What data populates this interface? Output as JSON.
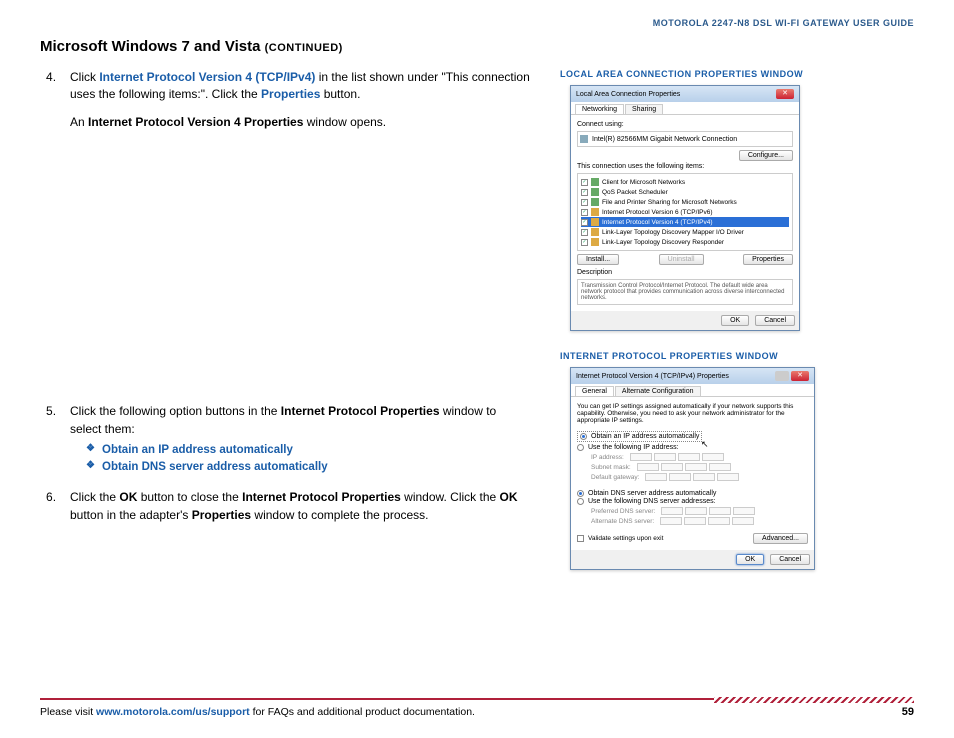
{
  "header": {
    "guide_title": "MOTOROLA 2247-N8 DSL WI-FI GATEWAY USER GUIDE"
  },
  "title": {
    "main": "Microsoft Windows 7 and Vista",
    "cont": "(CONTINUED)"
  },
  "steps": {
    "s4": {
      "pre": "Click ",
      "link": "Internet Protocol Version 4 (TCP/IPv4)",
      "mid": " in the list shown under \"This connection uses the following items:\". Click the ",
      "link2": "Properties",
      "end": " button.",
      "sub_pre": "An ",
      "sub_bold": "Internet Protocol Version 4 Properties",
      "sub_end": " window opens."
    },
    "s5": {
      "pre": "Click the following option buttons in the ",
      "bold": "Internet Protocol Properties",
      "end": " window to select them:",
      "opt1": "Obtain an IP address automatically",
      "opt2": "Obtain DNS server address automatically"
    },
    "s6": {
      "pre": "Click the ",
      "b1": "OK",
      "mid1": " button to close the ",
      "b2": "Internet Protocol Properties",
      "mid2": " window. Click the ",
      "b3": "OK",
      "mid3": " button in the adapter's ",
      "b4": "Properties",
      "end": " window to complete the process."
    }
  },
  "fig1": {
    "caption": "LOCAL AREA CONNECTION PROPERTIES WINDOW",
    "title": "Local Area Connection Properties",
    "tab1": "Networking",
    "tab2": "Sharing",
    "connect_label": "Connect using:",
    "adapter": "Intel(R) 82566MM Gigabit Network Connection",
    "configure": "Configure...",
    "list_label": "This connection uses the following items:",
    "items": [
      "Client for Microsoft Networks",
      "QoS Packet Scheduler",
      "File and Printer Sharing for Microsoft Networks",
      "Internet Protocol Version 6 (TCP/IPv6)",
      "Internet Protocol Version 4 (TCP/IPv4)",
      "Link-Layer Topology Discovery Mapper I/O Driver",
      "Link-Layer Topology Discovery Responder"
    ],
    "install": "Install...",
    "uninstall": "Uninstall",
    "properties": "Properties",
    "desc_label": "Description",
    "desc": "Transmission Control Protocol/Internet Protocol. The default wide area network protocol that provides communication across diverse interconnected networks.",
    "ok": "OK",
    "cancel": "Cancel"
  },
  "fig2": {
    "caption": "INTERNET PROTOCOL PROPERTIES WINDOW",
    "title": "Internet Protocol Version 4 (TCP/IPv4) Properties",
    "tab1": "General",
    "tab2": "Alternate Configuration",
    "intro": "You can get IP settings assigned automatically if your network supports this capability. Otherwise, you need to ask your network administrator for the appropriate IP settings.",
    "r1": "Obtain an IP address automatically",
    "r2": "Use the following IP address:",
    "ip": "IP address:",
    "subnet": "Subnet mask:",
    "gateway": "Default gateway:",
    "r3": "Obtain DNS server address automatically",
    "r4": "Use the following DNS server addresses:",
    "dns1": "Preferred DNS server:",
    "dns2": "Alternate DNS server:",
    "validate": "Validate settings upon exit",
    "advanced": "Advanced...",
    "ok": "OK",
    "cancel": "Cancel"
  },
  "footer": {
    "pre": "Please visit ",
    "link": "www.motorola.com/us/support",
    "post": " for FAQs and additional product documentation.",
    "page": "59"
  }
}
